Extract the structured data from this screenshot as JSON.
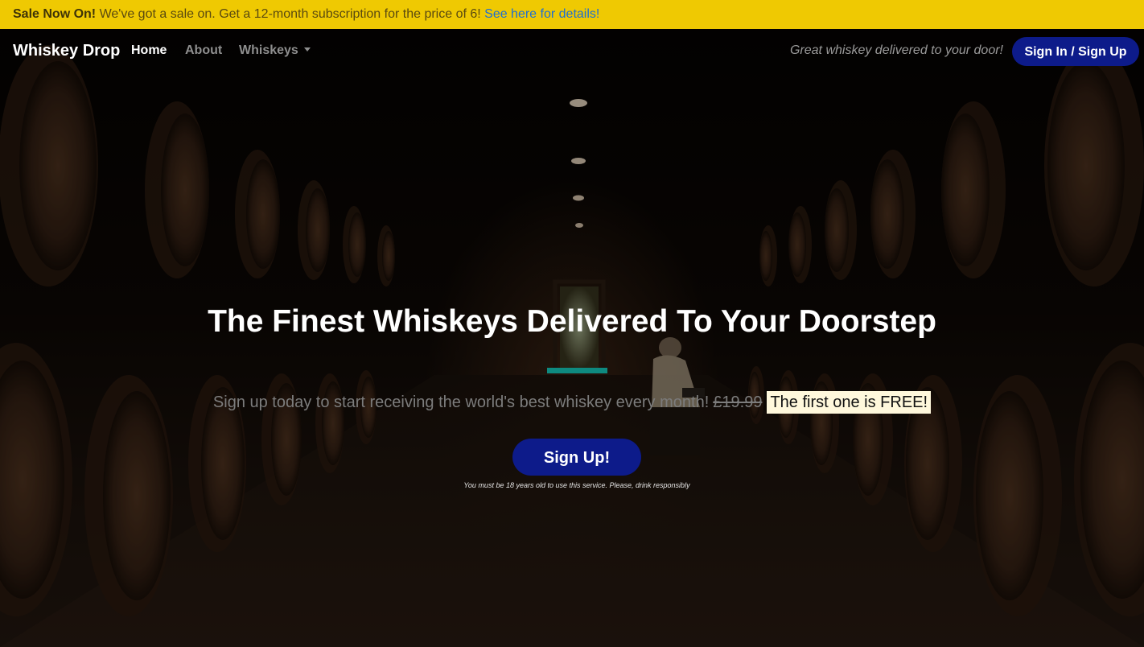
{
  "sale_banner": {
    "bold_text": "Sale Now On!",
    "text": " We've got a sale on. Get a 12-month subscription for the price of 6! ",
    "link_text": "See here for details!"
  },
  "navbar": {
    "brand": "Whiskey Drop",
    "items": [
      {
        "label": "Home",
        "active": true
      },
      {
        "label": "About",
        "active": false
      },
      {
        "label": "Whiskeys",
        "active": false,
        "dropdown": true
      }
    ],
    "tagline": "Great whiskey delivered to your door!",
    "signin_label": "Sign In / Sign Up"
  },
  "hero": {
    "title": "The Finest Whiskeys Delivered To Your Doorstep",
    "subtitle": "Sign up today to start receiving the world's best whiskey every month!",
    "old_price": "£19.99",
    "free_text": "The first one is FREE!",
    "cta_label": "Sign Up!",
    "disclaimer": "You must be 18 years old to use this service. Please, drink responsibly"
  },
  "colors": {
    "banner_bg": "#efc902",
    "link": "#1f6fd1",
    "button_bg": "#0d1b8a",
    "accent": "#0e8a80",
    "free_highlight": "#fff8dc"
  }
}
